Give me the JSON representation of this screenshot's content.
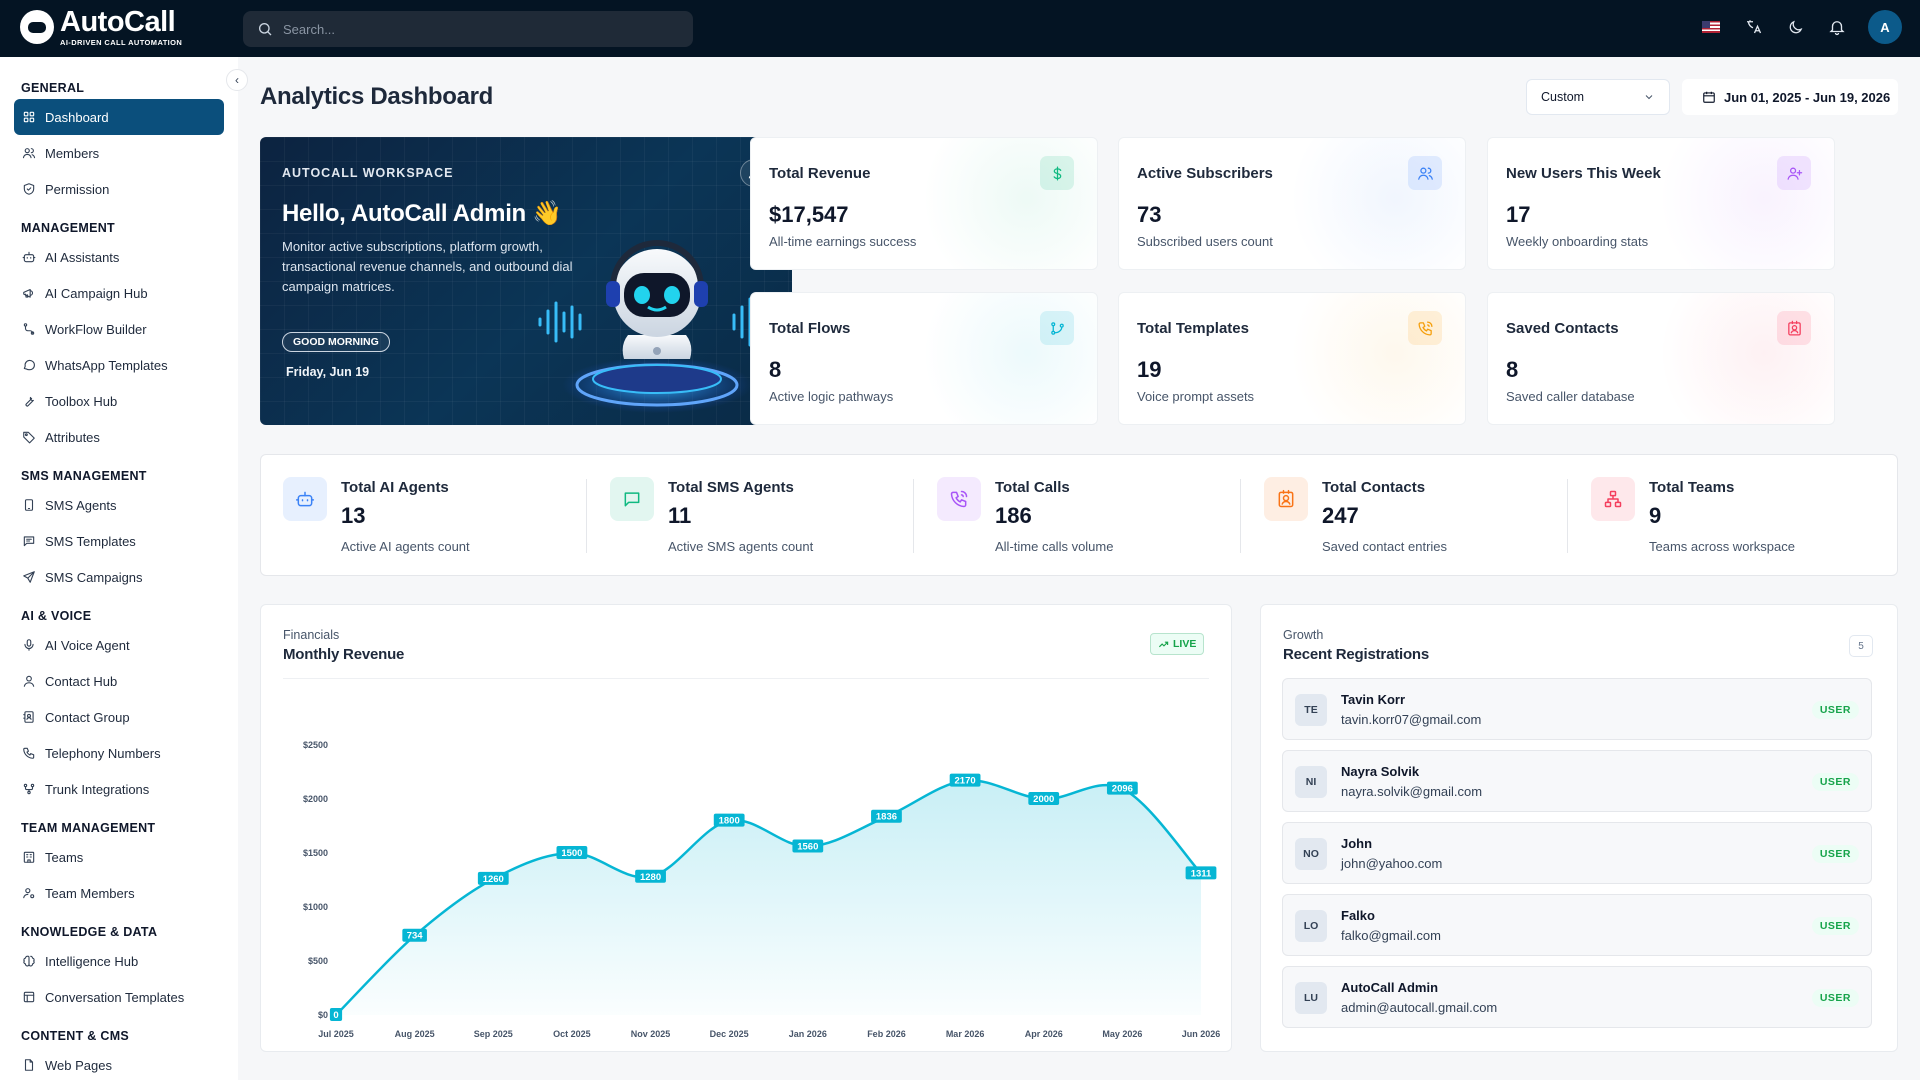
{
  "brand": {
    "name": "AutoCall",
    "tagline": "AI-DRIVEN CALL AUTOMATION"
  },
  "search": {
    "placeholder": "Search..."
  },
  "topbar": {
    "avatar_initial": "A",
    "icons": [
      "us-flag-icon",
      "translate-icon",
      "moon-icon",
      "bell-icon"
    ]
  },
  "sidebar": {
    "sections": [
      {
        "title": "GENERAL",
        "items": [
          {
            "label": "Dashboard",
            "icon": "grid-icon",
            "active": true
          },
          {
            "label": "Members",
            "icon": "users-icon"
          },
          {
            "label": "Permission",
            "icon": "shield-icon"
          }
        ]
      },
      {
        "title": "MANAGEMENT",
        "items": [
          {
            "label": "AI Assistants",
            "icon": "bot-icon"
          },
          {
            "label": "AI Campaign Hub",
            "icon": "megaphone-icon"
          },
          {
            "label": "WorkFlow Builder",
            "icon": "workflow-icon"
          },
          {
            "label": "WhatsApp Templates",
            "icon": "chat-icon"
          },
          {
            "label": "Toolbox Hub",
            "icon": "wrench-icon"
          },
          {
            "label": "Attributes",
            "icon": "tag-icon"
          }
        ]
      },
      {
        "title": "SMS MANAGEMENT",
        "items": [
          {
            "label": "SMS Agents",
            "icon": "phone-device-icon"
          },
          {
            "label": "SMS Templates",
            "icon": "message-icon"
          },
          {
            "label": "SMS Campaigns",
            "icon": "send-icon"
          }
        ]
      },
      {
        "title": "AI & VOICE",
        "items": [
          {
            "label": "AI Voice Agent",
            "icon": "mic-icon"
          },
          {
            "label": "Contact Hub",
            "icon": "user-icon"
          },
          {
            "label": "Contact Group",
            "icon": "contact-book-icon"
          },
          {
            "label": "Telephony Numbers",
            "icon": "phone-icon"
          },
          {
            "label": "Trunk Integrations",
            "icon": "network-icon"
          }
        ]
      },
      {
        "title": "TEAM MANAGEMENT",
        "items": [
          {
            "label": "Teams",
            "icon": "building-icon"
          },
          {
            "label": "Team Members",
            "icon": "user-cog-icon"
          }
        ]
      },
      {
        "title": "KNOWLEDGE & DATA",
        "items": [
          {
            "label": "Intelligence Hub",
            "icon": "brain-icon"
          },
          {
            "label": "Conversation Templates",
            "icon": "template-icon"
          }
        ]
      },
      {
        "title": "CONTENT & CMS",
        "items": [
          {
            "label": "Web Pages",
            "icon": "page-icon"
          }
        ]
      }
    ]
  },
  "header": {
    "title": "Analytics Dashboard",
    "range_select": "Custom",
    "date_range": "Jun 01, 2025 - Jun 19, 2026"
  },
  "hero": {
    "kicker": "AUTOCALL WORKSPACE",
    "title": "Hello, AutoCall Admin 👋",
    "description": "Monitor active subscriptions, platform growth, transactional revenue channels, and outbound dial campaign matrices.",
    "badge": "GOOD MORNING",
    "date": "Friday, Jun 19"
  },
  "stats": [
    {
      "label": "Total Revenue",
      "value": "$17,547",
      "sub": "All-time earnings success",
      "icon": "dollar-icon",
      "color": "#10b981"
    },
    {
      "label": "Active Subscribers",
      "value": "73",
      "sub": "Subscribed users count",
      "icon": "users-icon",
      "color": "#3b82f6"
    },
    {
      "label": "New Users This Week",
      "value": "17",
      "sub": "Weekly onboarding stats",
      "icon": "user-plus-icon",
      "color": "#a855f7"
    },
    {
      "label": "Total Flows",
      "value": "8",
      "sub": "Active logic pathways",
      "icon": "flow-icon",
      "color": "#06b6d4"
    },
    {
      "label": "Total Templates",
      "value": "19",
      "sub": "Voice prompt assets",
      "icon": "phone-call-icon",
      "color": "#f59e0b"
    },
    {
      "label": "Saved Contacts",
      "value": "8",
      "sub": "Saved caller database",
      "icon": "contact-icon",
      "color": "#f43f5e"
    }
  ],
  "strip": [
    {
      "label": "Total AI Agents",
      "value": "13",
      "sub": "Active AI agents count",
      "icon": "bot-icon",
      "color": "#3b82f6"
    },
    {
      "label": "Total SMS Agents",
      "value": "11",
      "sub": "Active SMS agents count",
      "icon": "message-square-icon",
      "color": "#10b981"
    },
    {
      "label": "Total Calls",
      "value": "186",
      "sub": "All-time calls volume",
      "icon": "phone-call-icon",
      "color": "#a855f7"
    },
    {
      "label": "Total Contacts",
      "value": "247",
      "sub": "Saved contact entries",
      "icon": "contact-icon",
      "color": "#f97316"
    },
    {
      "label": "Total Teams",
      "value": "9",
      "sub": "Teams across workspace",
      "icon": "hierarchy-icon",
      "color": "#f43f5e"
    }
  ],
  "revenue_panel": {
    "kicker": "Financials",
    "title": "Monthly Revenue",
    "live_label": "LIVE"
  },
  "chart_data": {
    "type": "area",
    "title": "Monthly Revenue",
    "categories": [
      "Jul 2025",
      "Aug 2025",
      "Sep 2025",
      "Oct 2025",
      "Nov 2025",
      "Dec 2025",
      "Jan 2026",
      "Feb 2026",
      "Mar 2026",
      "Apr 2026",
      "May 2026",
      "Jun 2026"
    ],
    "values": [
      0,
      734,
      1260,
      1500,
      1280,
      1800,
      1560,
      1836,
      2170,
      2000,
      2096,
      1311
    ],
    "y_ticks": [
      "$0",
      "$500",
      "$1000",
      "$1500",
      "$2000",
      "$2500"
    ],
    "ylim": [
      0,
      2500
    ],
    "color": "#06b6d4",
    "data_labels": true,
    "grid": false
  },
  "registrations": {
    "kicker": "Growth",
    "title": "Recent Registrations",
    "count": "5",
    "rows": [
      {
        "initials": "TE",
        "name": "Tavin Korr",
        "email": "tavin.korr07@gmail.com",
        "role": "USER"
      },
      {
        "initials": "NI",
        "name": "Nayra Solvik",
        "email": "nayra.solvik@gmail.com",
        "role": "USER"
      },
      {
        "initials": "NO",
        "name": "John",
        "email": "john@yahoo.com",
        "role": "USER"
      },
      {
        "initials": "LO",
        "name": "Falko",
        "email": "falko@gmail.com",
        "role": "USER"
      },
      {
        "initials": "LU",
        "name": "AutoCall Admin",
        "email": "admin@autocall.gmail.com",
        "role": "USER"
      }
    ]
  }
}
